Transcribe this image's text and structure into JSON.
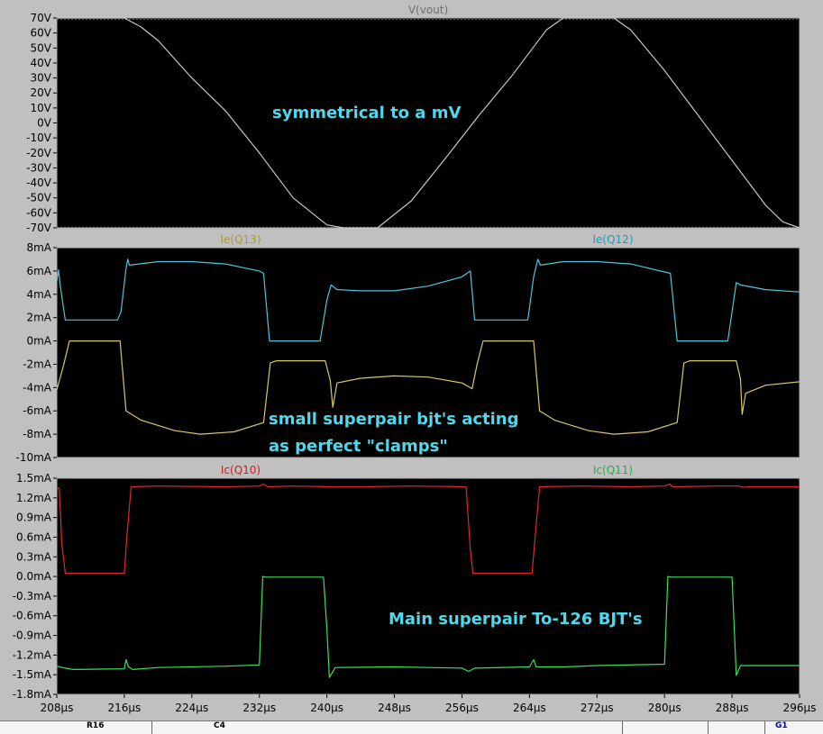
{
  "chart_data": [
    {
      "type": "line",
      "title": "V(vout)",
      "ylim": [
        -70,
        70
      ],
      "xlim": [
        208,
        296
      ],
      "yticks": [
        "70V",
        "60V",
        "50V",
        "40V",
        "30V",
        "20V",
        "10V",
        "0V",
        "-10V",
        "-20V",
        "-30V",
        "-40V",
        "-50V",
        "-60V",
        "-70V"
      ],
      "series": [
        {
          "name": "V(vout)",
          "color": "#c8c8c8",
          "points": [
            [
              208,
              70
            ],
            [
              210,
              70
            ],
            [
              212,
              70
            ],
            [
              216,
              70
            ],
            [
              218,
              64
            ],
            [
              220,
              55
            ],
            [
              224,
              30
            ],
            [
              228,
              8
            ],
            [
              232,
              -20
            ],
            [
              236,
              -50
            ],
            [
              240,
              -68
            ],
            [
              242,
              -70
            ],
            [
              244,
              -70
            ],
            [
              246,
              -70
            ],
            [
              250,
              -52
            ],
            [
              254,
              -24
            ],
            [
              258,
              5
            ],
            [
              262,
              32
            ],
            [
              266,
              62
            ],
            [
              268,
              70
            ],
            [
              272,
              70
            ],
            [
              274,
              70
            ],
            [
              276,
              62
            ],
            [
              280,
              35
            ],
            [
              284,
              5
            ],
            [
              288,
              -25
            ],
            [
              292,
              -55
            ],
            [
              294,
              -66
            ],
            [
              296,
              -70
            ]
          ]
        }
      ],
      "annotations": [
        "symmetrical to a mV"
      ]
    },
    {
      "type": "line",
      "ylim": [
        -10,
        8
      ],
      "xlim": [
        208,
        296
      ],
      "yticks": [
        "8mA",
        "6mA",
        "4mA",
        "2mA",
        "0mA",
        "-2mA",
        "-4mA",
        "-6mA",
        "-8mA",
        "-10mA"
      ],
      "series": [
        {
          "name": "Ie(Q13)",
          "color": "#d8c86c",
          "points": [
            [
              208,
              -4.2
            ],
            [
              208.8,
              -2.1
            ],
            [
              209.5,
              0
            ],
            [
              215.5,
              0
            ],
            [
              216.2,
              -6
            ],
            [
              218,
              -6.8
            ],
            [
              222,
              -7.7
            ],
            [
              225,
              -8
            ],
            [
              229,
              -7.8
            ],
            [
              232.5,
              -7
            ],
            [
              233.3,
              -1.9
            ],
            [
              234,
              -1.7
            ],
            [
              239.8,
              -1.7
            ],
            [
              240.4,
              -3.4
            ],
            [
              240.7,
              -5.7
            ],
            [
              241.2,
              -3.6
            ],
            [
              244,
              -3.2
            ],
            [
              248,
              -3
            ],
            [
              252,
              -3.1
            ],
            [
              256,
              -3.6
            ],
            [
              257.2,
              -4.1
            ],
            [
              257.8,
              -2
            ],
            [
              258.5,
              0
            ],
            [
              264.5,
              0
            ],
            [
              265.2,
              -6
            ],
            [
              267,
              -6.8
            ],
            [
              271,
              -7.7
            ],
            [
              274,
              -8
            ],
            [
              278,
              -7.8
            ],
            [
              281.5,
              -7
            ],
            [
              282.3,
              -1.9
            ],
            [
              283,
              -1.7
            ],
            [
              288.5,
              -1.7
            ],
            [
              289,
              -3.3
            ],
            [
              289.2,
              -6.3
            ],
            [
              289.6,
              -4.5
            ],
            [
              292,
              -3.8
            ],
            [
              296,
              -3.5
            ]
          ]
        },
        {
          "name": "Ie(Q12)",
          "color": "#52c4dc",
          "points": [
            [
              208,
              5.1
            ],
            [
              208.2,
              6.1
            ],
            [
              208.4,
              4.8
            ],
            [
              209,
              1.8
            ],
            [
              215.2,
              1.8
            ],
            [
              215.6,
              2.5
            ],
            [
              216.2,
              6.2
            ],
            [
              216.4,
              7
            ],
            [
              216.6,
              6.5
            ],
            [
              220,
              6.8
            ],
            [
              224,
              6.8
            ],
            [
              228,
              6.6
            ],
            [
              232,
              6
            ],
            [
              232.5,
              5.8
            ],
            [
              233.2,
              0
            ],
            [
              239.2,
              0
            ],
            [
              240,
              3.5
            ],
            [
              240.5,
              4.8
            ],
            [
              241.2,
              4.4
            ],
            [
              244,
              4.3
            ],
            [
              248,
              4.3
            ],
            [
              252,
              4.7
            ],
            [
              256,
              5.5
            ],
            [
              257,
              6
            ],
            [
              257.5,
              1.8
            ],
            [
              263.8,
              1.8
            ],
            [
              264.5,
              5.5
            ],
            [
              265,
              7
            ],
            [
              265.3,
              6.5
            ],
            [
              268,
              6.8
            ],
            [
              272,
              6.8
            ],
            [
              276,
              6.6
            ],
            [
              280.7,
              5.8
            ],
            [
              281.5,
              0
            ],
            [
              287.5,
              0
            ],
            [
              288.5,
              5
            ],
            [
              289,
              4.8
            ],
            [
              292,
              4.4
            ],
            [
              296,
              4.2
            ]
          ]
        }
      ],
      "annotations": [
        "small superpair bjt's acting",
        "as perfect \"clamps\""
      ]
    },
    {
      "type": "line",
      "ylim": [
        -1.8,
        1.5
      ],
      "xlim": [
        208,
        296
      ],
      "xticks": [
        "208µs",
        "216µs",
        "224µs",
        "232µs",
        "240µs",
        "248µs",
        "256µs",
        "264µs",
        "272µs",
        "280µs",
        "288µs",
        "296µs"
      ],
      "yticks": [
        "1.5mA",
        "1.2mA",
        "0.9mA",
        "0.6mA",
        "0.3mA",
        "0.0mA",
        "-0.3mA",
        "-0.6mA",
        "-0.9mA",
        "-1.2mA",
        "-1.5mA",
        "-1.8mA"
      ],
      "series": [
        {
          "name": "Ic(Q10)",
          "color": "#e02a2a",
          "points": [
            [
              208,
              1.37
            ],
            [
              208.3,
              1.33
            ],
            [
              208.6,
              0.5
            ],
            [
              209,
              0.05
            ],
            [
              216,
              0.05
            ],
            [
              216.3,
              0.6
            ],
            [
              216.8,
              1.37
            ],
            [
              220,
              1.38
            ],
            [
              228,
              1.37
            ],
            [
              232,
              1.38
            ],
            [
              232.5,
              1.41
            ],
            [
              233,
              1.37
            ],
            [
              236,
              1.38
            ],
            [
              240.5,
              1.37
            ],
            [
              244,
              1.37
            ],
            [
              250,
              1.38
            ],
            [
              256.5,
              1.37
            ],
            [
              257,
              0.4
            ],
            [
              257.3,
              0.05
            ],
            [
              264.3,
              0.05
            ],
            [
              264.8,
              0.8
            ],
            [
              265.2,
              1.37
            ],
            [
              270,
              1.38
            ],
            [
              276,
              1.37
            ],
            [
              280,
              1.38
            ],
            [
              280.6,
              1.41
            ],
            [
              281,
              1.37
            ],
            [
              286,
              1.38
            ],
            [
              288.8,
              1.38
            ],
            [
              289.3,
              1.36
            ],
            [
              290,
              1.37
            ],
            [
              296,
              1.37
            ]
          ]
        },
        {
          "name": "Ic(Q11)",
          "color": "#3ce05a",
          "points": [
            [
              208,
              -1.37
            ],
            [
              209,
              -1.4
            ],
            [
              210,
              -1.42
            ],
            [
              216,
              -1.41
            ],
            [
              216.2,
              -1.27
            ],
            [
              216.5,
              -1.38
            ],
            [
              217,
              -1.42
            ],
            [
              220,
              -1.39
            ],
            [
              228,
              -1.37
            ],
            [
              232,
              -1.35
            ],
            [
              232.4,
              0
            ],
            [
              232.8,
              -0.01
            ],
            [
              239.6,
              -0.01
            ],
            [
              240,
              -0.8
            ],
            [
              240.3,
              -1.54
            ],
            [
              241,
              -1.39
            ],
            [
              248,
              -1.38
            ],
            [
              252,
              -1.39
            ],
            [
              256,
              -1.4
            ],
            [
              256.8,
              -1.45
            ],
            [
              257.5,
              -1.4
            ],
            [
              264,
              -1.38
            ],
            [
              264.5,
              -1.27
            ],
            [
              264.8,
              -1.38
            ],
            [
              268,
              -1.38
            ],
            [
              272,
              -1.36
            ],
            [
              280,
              -1.34
            ],
            [
              280.4,
              0
            ],
            [
              280.8,
              -0.01
            ],
            [
              288,
              -0.01
            ],
            [
              288.3,
              -0.9
            ],
            [
              288.5,
              -1.51
            ],
            [
              289,
              -1.36
            ],
            [
              296,
              -1.36
            ]
          ]
        }
      ],
      "annotations": [
        "Main superpair To-126 BJT's"
      ]
    }
  ],
  "schematic": {
    "r16": "R16",
    "c4": "C4",
    "g1": "G1"
  }
}
